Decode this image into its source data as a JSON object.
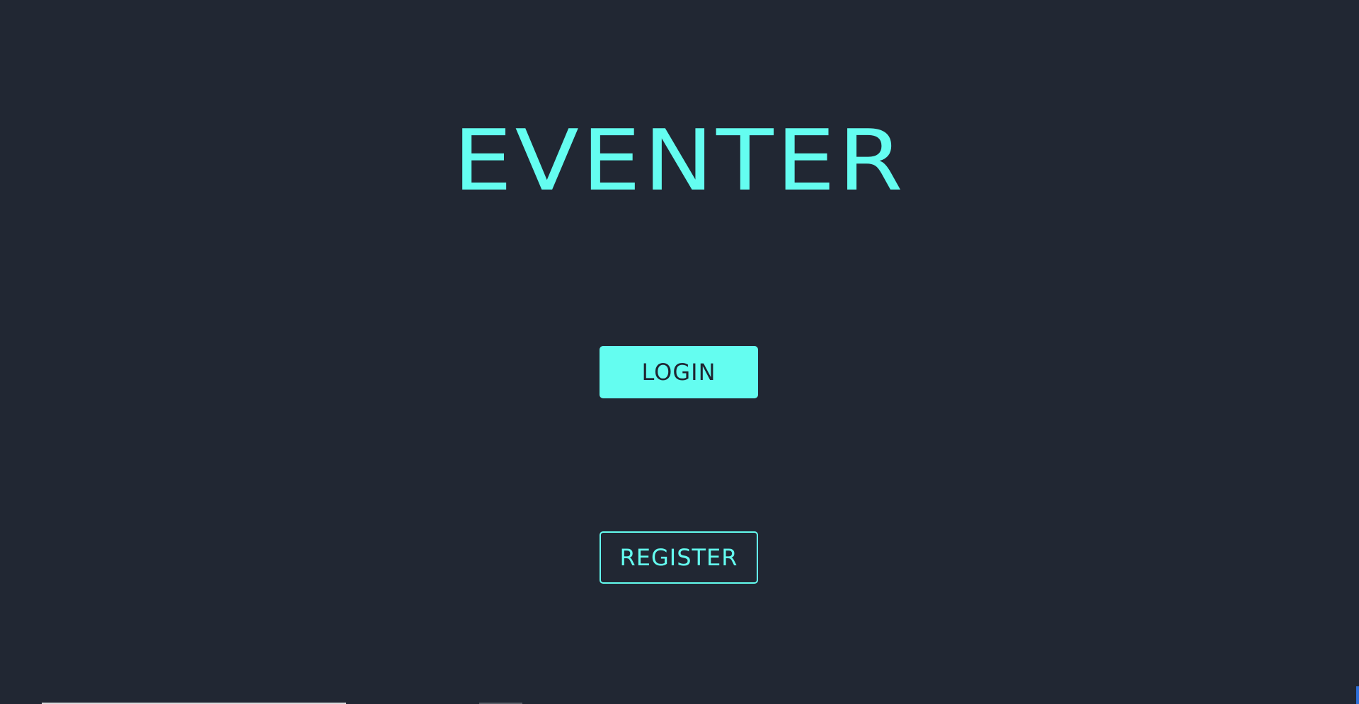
{
  "app": {
    "title": "EVENTER"
  },
  "actions": {
    "login_label": "LOGIN",
    "register_label": "REGISTER"
  },
  "colors": {
    "background": "#212733",
    "accent": "#64fdf0",
    "button_text_dark": "#1f2430"
  }
}
